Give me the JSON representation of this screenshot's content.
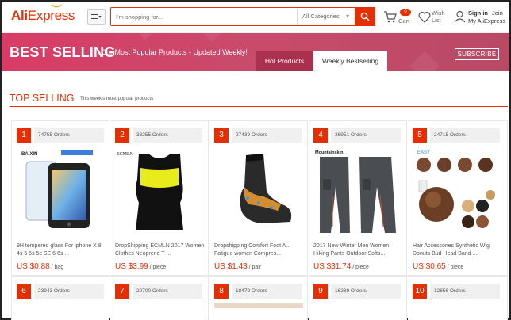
{
  "header": {
    "logo_ali": "Ali",
    "logo_express": "Express",
    "search_placeholder": "I'm shopping for...",
    "search_category": "All Categories",
    "cart_count": "0",
    "cart_label": "Cart",
    "wish_label_1": "Wish",
    "wish_label_2": "List",
    "signin": "Sign in",
    "join": "Join",
    "my_aliexpress": "My AliExpress"
  },
  "banner": {
    "title": "BEST SELLING",
    "subtitle": "Our Most Popular Products - Updated Weekly!",
    "tab_hot": "Hot Products",
    "tab_weekly": "Weekly Bestselling",
    "subscribe": "SUBSCRIBE"
  },
  "section": {
    "title": "TOP SELLING",
    "subtitle": "This week's most popular products"
  },
  "products": [
    {
      "rank": "1",
      "orders": "74755 Orders",
      "name": "9H tempered glass For iphone X 8 4s 5 5s 5c SE 6 6s ...",
      "price": "US $0.88",
      "unit": " / bag",
      "icon": "screen-protector-icon"
    },
    {
      "rank": "2",
      "orders": "33255 Orders",
      "name": "DropShipping ECMLN 2017 Women Clothes Neoprene T-...",
      "price": "US $3.99",
      "unit": " / piece",
      "icon": "shaper-vest-icon"
    },
    {
      "rank": "3",
      "orders": "27439 Orders",
      "name": "Dropshipping Comfort Foot A... Fatigue women Compres...",
      "price": "US $1.43",
      "unit": " / pair",
      "icon": "compression-sock-icon"
    },
    {
      "rank": "4",
      "orders": "26951 Orders",
      "name": "2017 New Winter Men Women Hiking Pants Outdoor Softs...",
      "price": "US $31.74",
      "unit": " / piece",
      "icon": "hiking-pants-icon"
    },
    {
      "rank": "5",
      "orders": "24715 Orders",
      "name": "Hair Accessories Synthetic Wig Donuts Bud Head Band ...",
      "price": "US $0.65",
      "unit": " / piece",
      "icon": "hair-bun-icon"
    }
  ],
  "products_row2": [
    {
      "rank": "6",
      "orders": "23943 Orders"
    },
    {
      "rank": "7",
      "orders": "20700 Orders"
    },
    {
      "rank": "8",
      "orders": "18479 Orders"
    },
    {
      "rank": "9",
      "orders": "16289 Orders"
    },
    {
      "rank": "10",
      "orders": "12856 Orders"
    }
  ],
  "colors": {
    "brand": "#e62e04",
    "banner": "#d83c66"
  }
}
